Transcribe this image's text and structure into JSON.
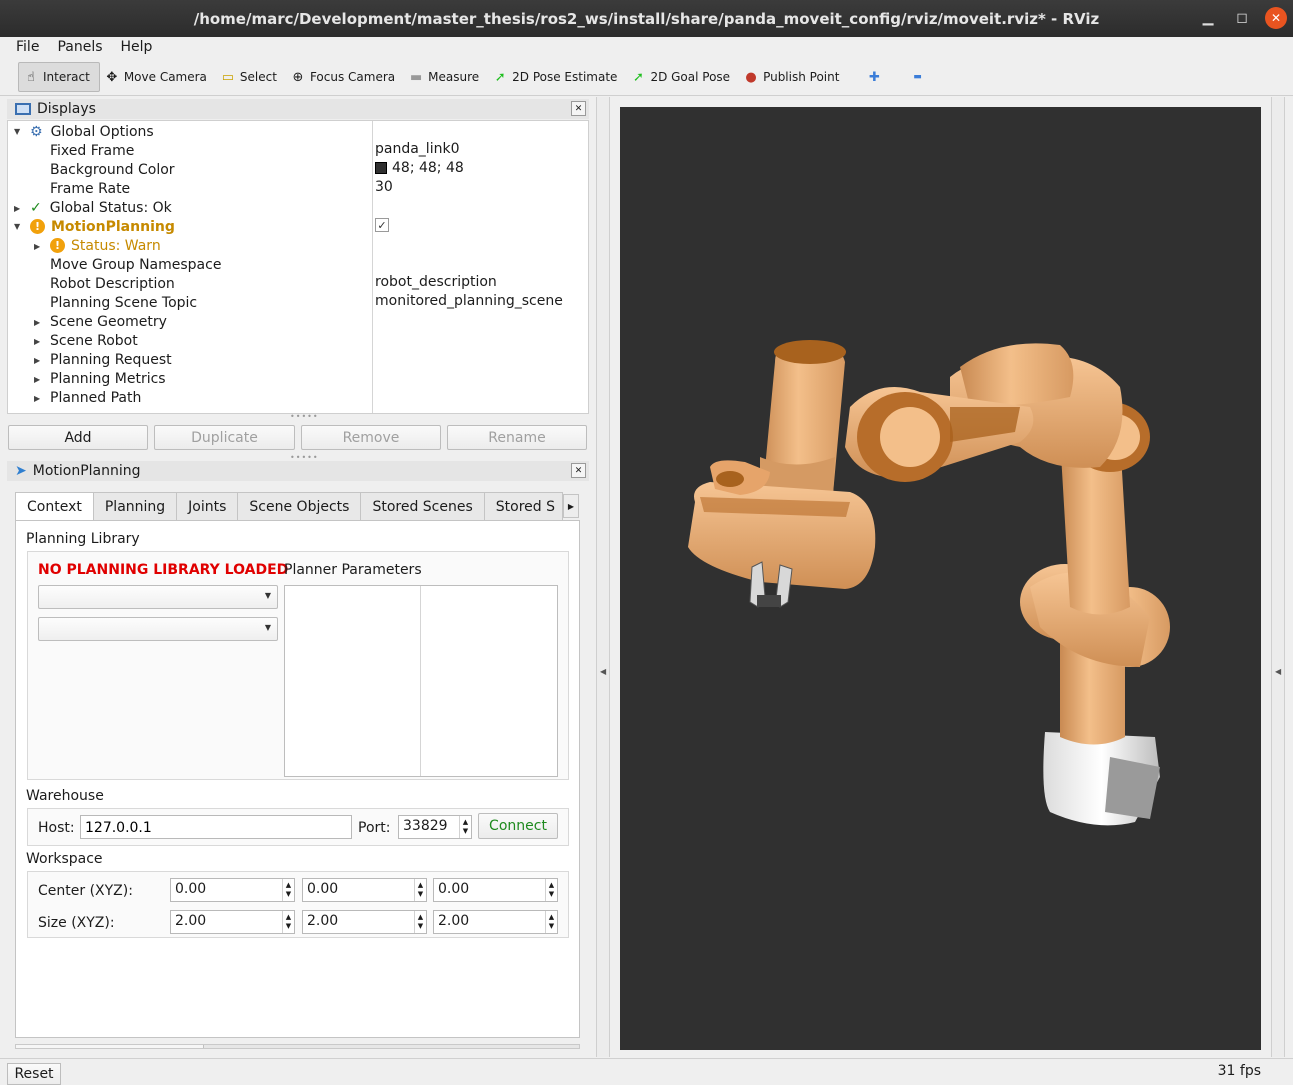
{
  "window": {
    "title": "/home/marc/Development/master_thesis/ros2_ws/install/share/panda_moveit_config/rviz/moveit.rviz* - RViz"
  },
  "menu": [
    "File",
    "Panels",
    "Help"
  ],
  "toolbar": {
    "tools": [
      {
        "label": "Interact",
        "icon": "hand-icon",
        "glyph": "☝"
      },
      {
        "label": "Move Camera",
        "icon": "move-camera-icon",
        "glyph": "✥"
      },
      {
        "label": "Select",
        "icon": "select-icon",
        "glyph": "▭"
      },
      {
        "label": "Focus Camera",
        "icon": "focus-camera-icon",
        "glyph": "⊕"
      },
      {
        "label": "Measure",
        "icon": "ruler-icon",
        "glyph": "▬"
      },
      {
        "label": "2D Pose Estimate",
        "icon": "pose-estimate-arrow-icon",
        "glyph": "➚"
      },
      {
        "label": "2D Goal Pose",
        "icon": "goal-pose-arrow-icon",
        "glyph": "➚"
      },
      {
        "label": "Publish Point",
        "icon": "map-pin-icon",
        "glyph": "●"
      }
    ],
    "add_glyph": "✚",
    "remove_glyph": "▬"
  },
  "displays": {
    "title": "Displays",
    "rows": [
      {
        "label": "Global Options",
        "value": ""
      },
      {
        "label": "Fixed Frame",
        "value": "panda_link0"
      },
      {
        "label": "Background Color",
        "value": "48; 48; 48"
      },
      {
        "label": "Frame Rate",
        "value": "30"
      },
      {
        "label": "Global Status: Ok",
        "value": ""
      },
      {
        "label": "MotionPlanning",
        "value": "✓"
      },
      {
        "label": "Status: Warn",
        "value": ""
      },
      {
        "label": "Move Group Namespace",
        "value": ""
      },
      {
        "label": "Robot Description",
        "value": "robot_description"
      },
      {
        "label": "Planning Scene Topic",
        "value": "monitored_planning_scene"
      },
      {
        "label": "Scene Geometry",
        "value": ""
      },
      {
        "label": "Scene Robot",
        "value": ""
      },
      {
        "label": "Planning Request",
        "value": ""
      },
      {
        "label": "Planning Metrics",
        "value": ""
      },
      {
        "label": "Planned Path",
        "value": ""
      }
    ],
    "buttons": {
      "add": "Add",
      "duplicate": "Duplicate",
      "remove": "Remove",
      "rename": "Rename"
    },
    "bg_color": "#303030"
  },
  "motion_planning": {
    "title": "MotionPlanning",
    "tabs": [
      "Context",
      "Planning",
      "Joints",
      "Scene Objects",
      "Stored Scenes",
      "Stored S"
    ],
    "planning_library_label": "Planning Library",
    "no_library": "NO PLANNING LIBRARY LOADED",
    "planner_params_label": "Planner Parameters",
    "warehouse_label": "Warehouse",
    "host_label": "Host:",
    "host_value": "127.0.0.1",
    "port_label": "Port:",
    "port_value": "33829",
    "connect_label": "Connect",
    "workspace_label": "Workspace",
    "center_label": "Center (XYZ):",
    "size_label": "Size (XYZ):",
    "center": [
      "0.00",
      "0.00",
      "0.00"
    ],
    "size": [
      "2.00",
      "2.00",
      "2.00"
    ]
  },
  "status": {
    "reset": "Reset",
    "fps": "31 fps"
  },
  "colors": {
    "robot": "#f0b27a",
    "robot_dark": "#a8621e",
    "base": "#f2f2f2",
    "warn": "#c68a00",
    "error": "#e00000",
    "connect": "#1e8a1e"
  }
}
